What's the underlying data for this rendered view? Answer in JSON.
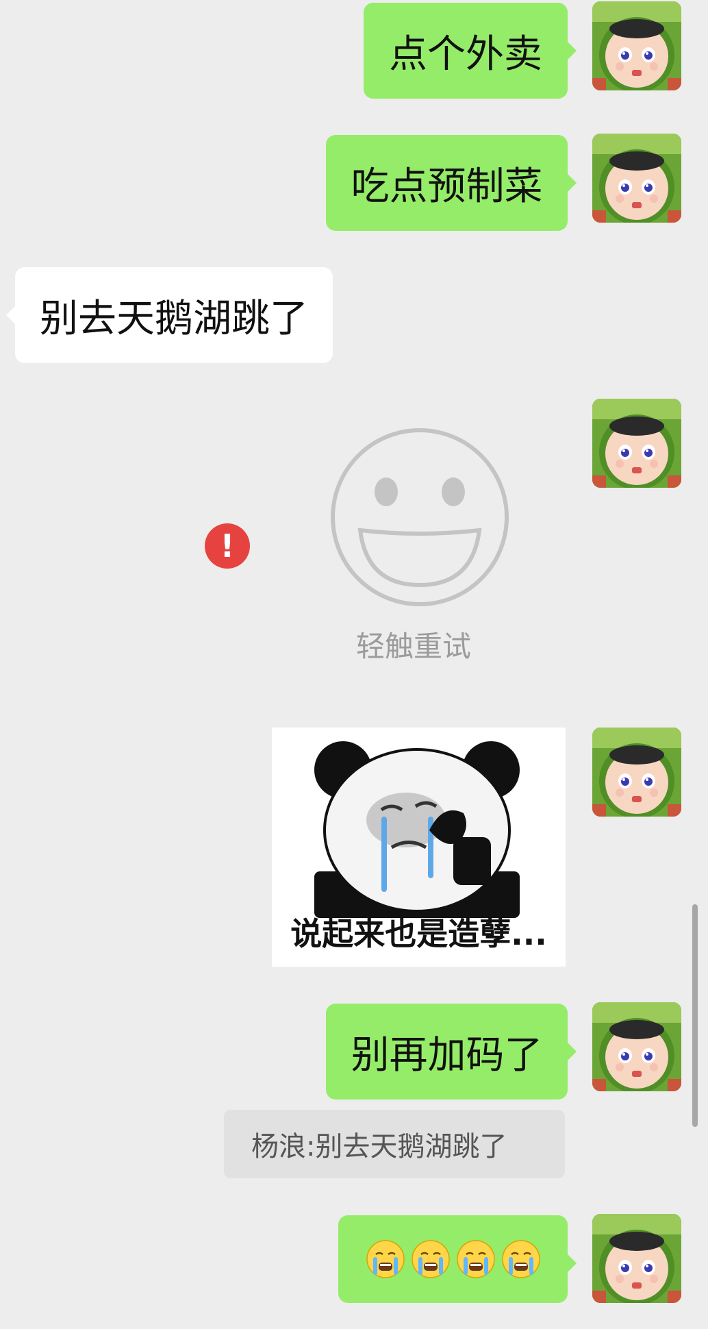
{
  "messages": {
    "m1": "点个外卖",
    "m2": "吃点预制菜",
    "m3": "别去天鹅湖跳了",
    "m6": "别再加码了"
  },
  "failed_sticker": {
    "retry_label": "轻触重试",
    "error_symbol": "!"
  },
  "sticker": {
    "caption": "说起来也是造孽..."
  },
  "quote": {
    "text": "杨浪:别去天鹅湖跳了"
  },
  "last_message": {
    "emoji": [
      "crying-face",
      "crying-face",
      "crying-face",
      "crying-face"
    ]
  },
  "colors": {
    "background": "#ededed",
    "outgoing_bubble": "#95ec69",
    "incoming_bubble": "#ffffff",
    "error": "#e64340"
  }
}
